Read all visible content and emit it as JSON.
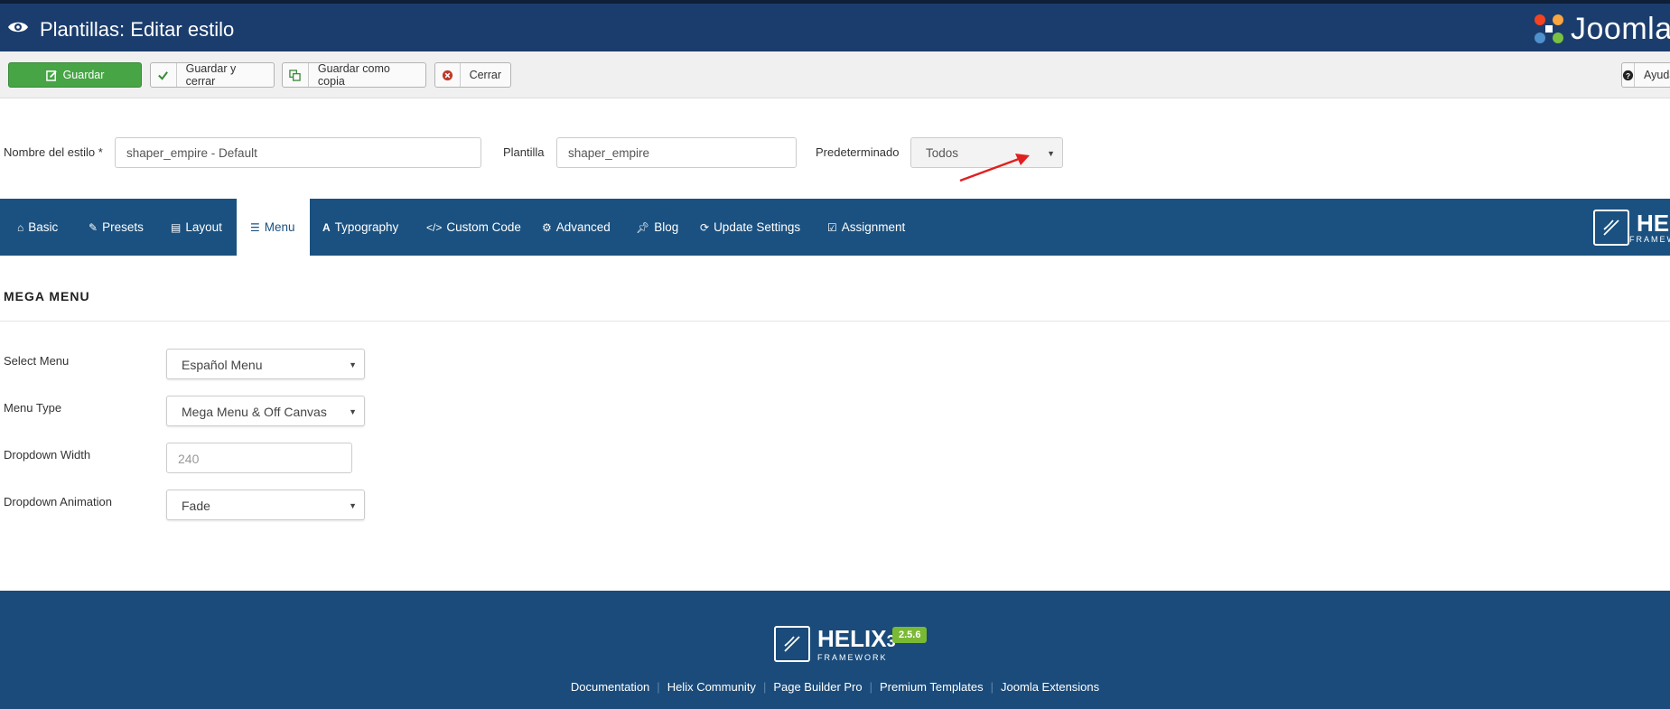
{
  "header": {
    "title": "Plantillas: Editar estilo",
    "brand": "Joomla!"
  },
  "toolbar": {
    "save": "Guardar",
    "save_close": "Guardar y cerrar",
    "save_copy": "Guardar como copia",
    "close": "Cerrar",
    "help": "Ayuda"
  },
  "form": {
    "style_name_label": "Nombre del estilo *",
    "style_name_value": "shaper_empire - Default",
    "template_label": "Plantilla",
    "template_value": "shaper_empire",
    "default_label": "Predeterminado",
    "default_value": "Todos"
  },
  "tabs": [
    {
      "label": "Basic",
      "icon": "home-icon"
    },
    {
      "label": "Presets",
      "icon": "brush-icon"
    },
    {
      "label": "Layout",
      "icon": "layout-icon"
    },
    {
      "label": "Menu",
      "icon": "list-icon"
    },
    {
      "label": "Typography",
      "icon": "font-icon"
    },
    {
      "label": "Custom Code",
      "icon": "code-icon"
    },
    {
      "label": "Advanced",
      "icon": "gear-icon"
    },
    {
      "label": "Blog",
      "icon": "pin-icon"
    },
    {
      "label": "Update Settings",
      "icon": "refresh-icon"
    },
    {
      "label": "Assignment",
      "icon": "check-square-icon"
    }
  ],
  "active_tab": "Menu",
  "helix_badge": {
    "name": "HELIX",
    "sub": "FRAMEWORK"
  },
  "section": {
    "title": "MEGA MENU",
    "fields": [
      {
        "label": "Select Menu",
        "value": "Español Menu"
      },
      {
        "label": "Menu Type",
        "value": "Mega Menu & Off Canvas"
      },
      {
        "label": "Dropdown Width",
        "value": "240"
      },
      {
        "label": "Dropdown Animation",
        "value": "Fade"
      }
    ]
  },
  "footer": {
    "brand_name": "HELIX",
    "brand_number": "3",
    "brand_sub": "FRAMEWORK",
    "version": "2.5.6",
    "links": [
      "Documentation",
      "Helix Community",
      "Page Builder Pro",
      "Premium Templates",
      "Joomla Extensions"
    ]
  },
  "colors": {
    "header_bg": "#1b3d6d",
    "tabs_bg": "#1a5180",
    "footer_bg": "#1a4b7a",
    "save_green": "#47a546",
    "version_green": "#7ab934",
    "annotation_arrow": "#e02020"
  }
}
